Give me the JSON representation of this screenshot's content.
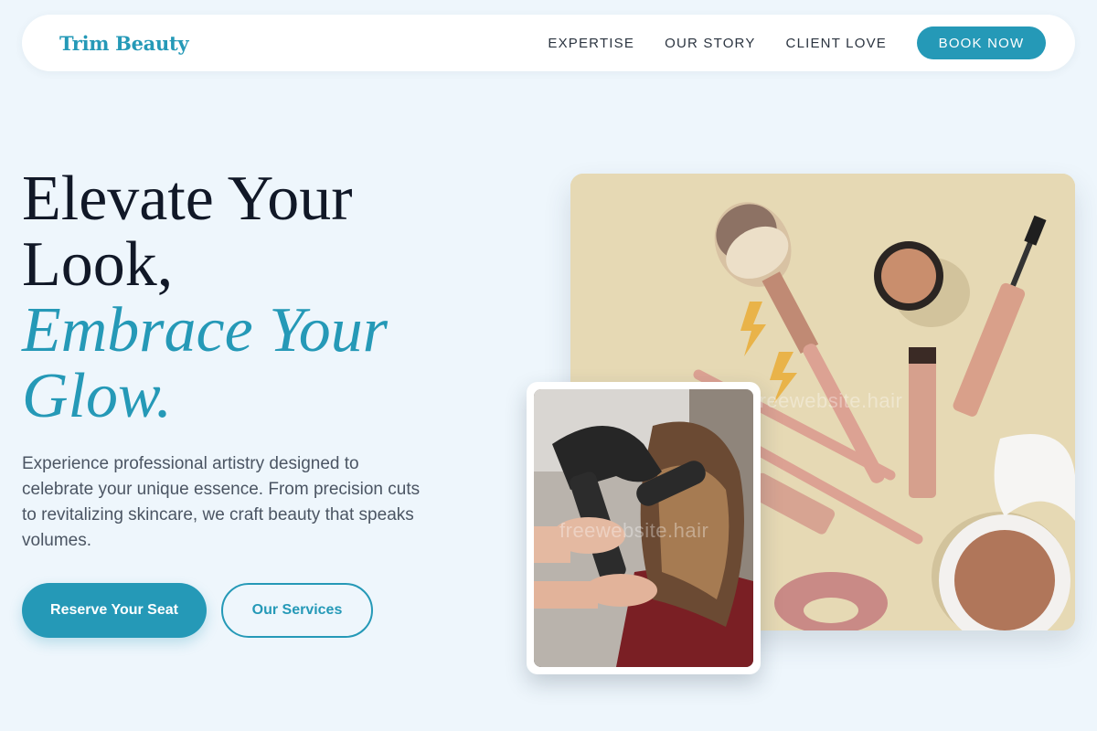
{
  "nav": {
    "brand": "Trim Beauty",
    "links": [
      "EXPERTISE",
      "OUR STORY",
      "CLIENT LOVE"
    ],
    "cta": "BOOK NOW"
  },
  "hero": {
    "title_line1": "Elevate Your",
    "title_line2": "Look,",
    "title_accent1": "Embrace Your",
    "title_accent2": "Glow.",
    "description": "Experience professional artistry designed to celebrate your unique essence. From precision cuts to revitalizing skincare, we craft beauty that speaks volumes.",
    "primary_button": "Reserve Your Seat",
    "secondary_button": "Our Services"
  },
  "images": {
    "watermark": "freewebsite.hair"
  },
  "colors": {
    "accent": "#2599b7",
    "background": "#eef6fc",
    "heading": "#111827"
  }
}
